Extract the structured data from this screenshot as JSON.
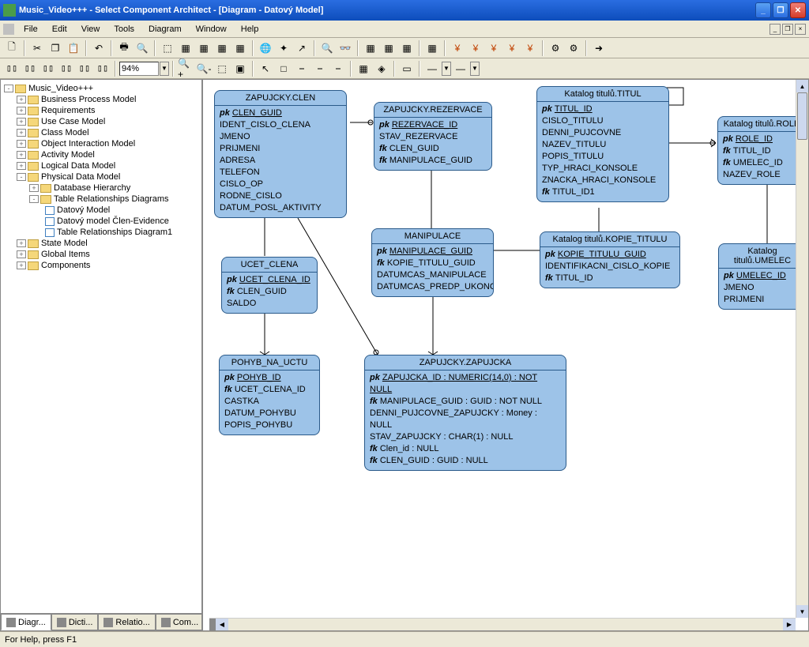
{
  "titlebar": {
    "title": "Music_Video+++ - Select Component Architect - [Diagram - Datový Model]"
  },
  "menu": {
    "file": "File",
    "edit": "Edit",
    "view": "View",
    "tools": "Tools",
    "diagram": "Diagram",
    "window": "Window",
    "help": "Help"
  },
  "toolbar": {
    "zoom_value": "94%"
  },
  "tree": {
    "root": "Music_Video+++",
    "n0": "Business Process Model",
    "n1": "Requirements",
    "n2": "Use Case Model",
    "n3": "Class Model",
    "n4": "Object Interaction Model",
    "n5": "Activity Model",
    "n6": "Logical Data Model",
    "n7": "Physical Data Model",
    "n7a": "Database Hierarchy",
    "n7b": "Table Relationships Diagrams",
    "n7b1": "Datový Model",
    "n7b2": "Datový model Člen-Evidence",
    "n7b3": "Table Relationships Diagram1",
    "n8": "State Model",
    "n9": "Global Items",
    "n10": "Components"
  },
  "tabs": {
    "t0": "Diagr...",
    "t1": "Dicti...",
    "t2": "Relatio...",
    "t3": "Com..."
  },
  "entities": {
    "clen": {
      "name": "ZAPUJCKY.CLEN",
      "a0": {
        "p": "pk",
        "t": "CLEN_GUID",
        "u": 1
      },
      "a1": {
        "t": "IDENT_CISLO_CLENA"
      },
      "a2": {
        "t": "JMENO"
      },
      "a3": {
        "t": "PRIJMENI"
      },
      "a4": {
        "t": "ADRESA"
      },
      "a5": {
        "t": "TELEFON"
      },
      "a6": {
        "t": "CISLO_OP"
      },
      "a7": {
        "t": "RODNE_CISLO"
      },
      "a8": {
        "t": "DATUM_POSL_AKTIVITY"
      }
    },
    "rezervace": {
      "name": "ZAPUJCKY.REZERVACE",
      "a0": {
        "p": "pk",
        "t": "REZERVACE_ID",
        "u": 1
      },
      "a1": {
        "t": "STAV_REZERVACE"
      },
      "a2": {
        "p": "fk",
        "t": "CLEN_GUID"
      },
      "a3": {
        "p": "fk",
        "t": "MANIPULACE_GUID"
      }
    },
    "titul": {
      "name": "Katalog titulů.TITUL",
      "a0": {
        "p": "pk",
        "t": "TITUL_ID",
        "u": 1
      },
      "a1": {
        "t": "CISLO_TITULU"
      },
      "a2": {
        "t": "DENNI_PUJCOVNE"
      },
      "a3": {
        "t": "NAZEV_TITULU"
      },
      "a4": {
        "t": "POPIS_TITULU"
      },
      "a5": {
        "t": "TYP_HRACI_KONSOLE"
      },
      "a6": {
        "t": "ZNACKA_HRACI_KONSOLE"
      },
      "a7": {
        "p": "fk",
        "t": "TITUL_ID1"
      }
    },
    "role": {
      "name": "Katalog titulů.ROLE",
      "a0": {
        "p": "pk",
        "t": "ROLE_ID",
        "u": 1
      },
      "a1": {
        "p": "fk",
        "t": "TITUL_ID"
      },
      "a2": {
        "p": "fk",
        "t": "UMELEC_ID"
      },
      "a3": {
        "t": "NAZEV_ROLE"
      }
    },
    "ucet": {
      "name": "UCET_CLENA",
      "a0": {
        "p": "pk",
        "t": "UCET_CLENA_ID",
        "u": 1
      },
      "a1": {
        "p": "fk",
        "t": "CLEN_GUID"
      },
      "a2": {
        "t": "SALDO"
      }
    },
    "manipulace": {
      "name": "MANIPULACE",
      "a0": {
        "p": "pk",
        "t": "MANIPULACE_GUID",
        "u": 1
      },
      "a1": {
        "p": "fk",
        "t": "KOPIE_TITULU_GUID"
      },
      "a2": {
        "t": "DATUMCAS_MANIPULACE"
      },
      "a3": {
        "t": "DATUMCAS_PREDP_UKONC"
      }
    },
    "kopie": {
      "name": "Katalog titulů.KOPIE_TITULU",
      "a0": {
        "p": "pk",
        "t": "KOPIE_TITULU_GUID",
        "u": 1
      },
      "a1": {
        "t": "IDENTIFIKACNI_CISLO_KOPIE"
      },
      "a2": {
        "p": "fk",
        "t": "TITUL_ID"
      }
    },
    "umelec": {
      "name": "Katalog titulů.UMELEC",
      "a0": {
        "p": "pk",
        "t": "UMELEC_ID",
        "u": 1
      },
      "a1": {
        "t": "JMENO"
      },
      "a2": {
        "t": "PRIJMENI"
      }
    },
    "pohyb": {
      "name": "POHYB_NA_UCTU",
      "a0": {
        "p": "pk",
        "t": "POHYB_ID",
        "u": 1
      },
      "a1": {
        "p": "fk",
        "t": "UCET_CLENA_ID"
      },
      "a2": {
        "t": "CASTKA"
      },
      "a3": {
        "t": "DATUM_POHYBU"
      },
      "a4": {
        "t": "POPIS_POHYBU"
      }
    },
    "zapujcka": {
      "name": "ZAPUJCKY.ZAPUJCKA",
      "a0": {
        "p": "pk",
        "t": "ZAPUJCKA_ID : NUMERIC(14,0) : NOT NULL",
        "u": 1
      },
      "a1": {
        "p": "fk",
        "t": "MANIPULACE_GUID : GUID : NOT NULL"
      },
      "a2": {
        "t": "DENNI_PUJCOVNE_ZAPUJCKY : Money : NULL"
      },
      "a3": {
        "t": "STAV_ZAPUJCKY : CHAR(1) : NULL"
      },
      "a4": {
        "p": "fk",
        "t": "Clen_id : NULL"
      },
      "a5": {
        "p": "fk",
        "t": "CLEN_GUID : GUID : NULL"
      }
    }
  },
  "status": {
    "text": "For Help, press F1"
  }
}
